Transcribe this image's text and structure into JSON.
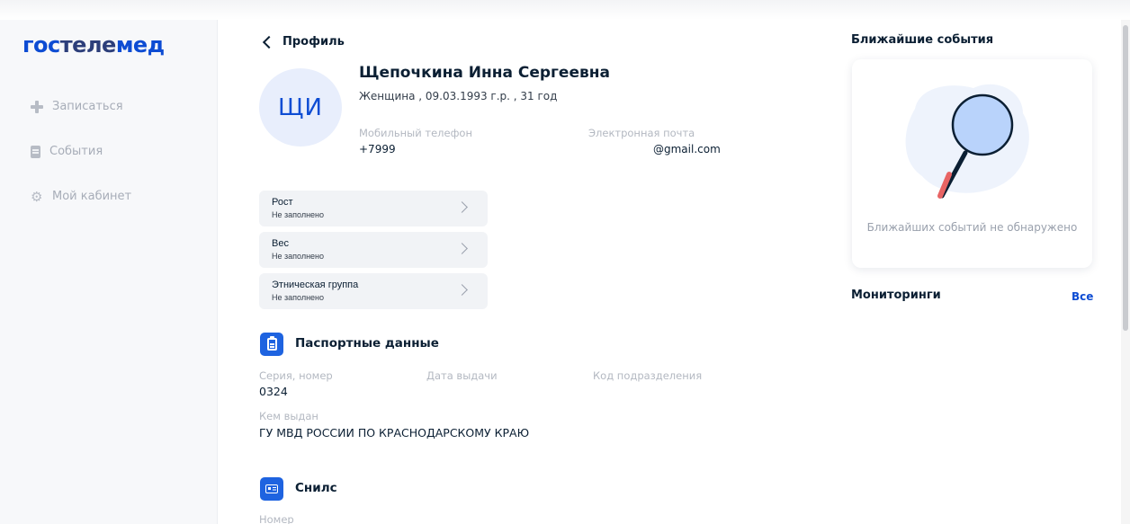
{
  "logo": {
    "part1": "гос",
    "part2": "теле",
    "part3": "мед"
  },
  "sidebar": {
    "items": [
      {
        "label": "Записаться",
        "icon": "plus-icon"
      },
      {
        "label": "События",
        "icon": "document-icon"
      },
      {
        "label": "Мой кабинет",
        "icon": "gear-icon"
      }
    ]
  },
  "header": {
    "back_label": "Профиль"
  },
  "profile": {
    "initials": "ЩИ",
    "full_name": "Щепочкина Инна Сергеевна",
    "info": "Женщина , 09.03.1993 г.р. , 31 год",
    "phone_label": "Мобильный телефон",
    "phone_value": "+7999",
    "email_label": "Электронная почта",
    "email_value": "@gmail.com"
  },
  "metrics": [
    {
      "label": "Рост",
      "value": "Не заполнено"
    },
    {
      "label": "Вес",
      "value": "Не заполнено"
    },
    {
      "label": "Этническая группа",
      "value": "Не заполнено"
    }
  ],
  "passport": {
    "title": "Паспортные данные",
    "series_label": "Серия, номер",
    "series_value": "0324",
    "date_label": "Дата выдачи",
    "code_label": "Код подразделения",
    "issuer_label": "Кем выдан",
    "issuer_value": "ГУ МВД РОССИИ ПО КРАСНОДАРСКОМУ КРАЮ"
  },
  "snils": {
    "title": "Снилс",
    "number_label": "Номер"
  },
  "events": {
    "title": "Ближайшие события",
    "empty_text": "Ближайших событий не обнаружено"
  },
  "monitoring": {
    "title": "Мониторинги",
    "all_label": "Все"
  },
  "colors": {
    "accent": "#0d4cd3",
    "sidebar_bg": "#f7f8fa",
    "card_bg": "#f1f3f6"
  }
}
